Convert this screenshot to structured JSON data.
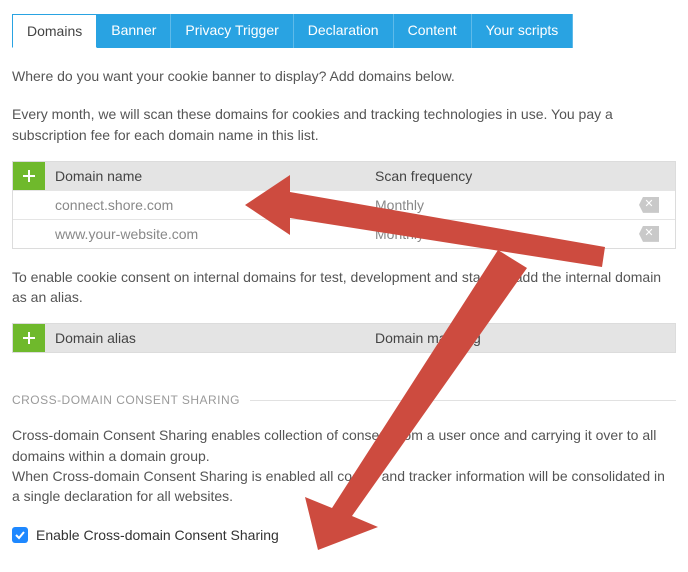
{
  "tabs": [
    {
      "label": "Domains",
      "active": true
    },
    {
      "label": "Banner"
    },
    {
      "label": "Privacy Trigger"
    },
    {
      "label": "Declaration"
    },
    {
      "label": "Content"
    },
    {
      "label": "Your scripts"
    }
  ],
  "intro1": "Where do you want your cookie banner to display? Add domains below.",
  "intro2": "Every month, we will scan these domains for cookies and tracking technologies in use. You pay a subscription fee for each domain name in this list.",
  "domainTable": {
    "head": {
      "name": "Domain name",
      "freq": "Scan frequency"
    },
    "rows": [
      {
        "name": "connect.shore.com",
        "freq": "Monthly"
      },
      {
        "name": "www.your-website.com",
        "freq": "Monthly"
      }
    ]
  },
  "aliasIntro": "To enable cookie consent on internal domains for test, development and staging, add the internal domain as an alias.",
  "aliasTable": {
    "head": {
      "alias": "Domain alias",
      "mapping": "Domain mapping"
    }
  },
  "sectionTitle": "CROSS-DOMAIN CONSENT SHARING",
  "crossText1": "Cross-domain Consent Sharing enables collection of consent from a user once and carrying it over to all domains within a domain group.",
  "crossText2": "When Cross-domain Consent Sharing is enabled all cookie and tracker information will be consolidated in a single declaration for all websites.",
  "checkboxLabel": "Enable Cross-domain Consent Sharing"
}
